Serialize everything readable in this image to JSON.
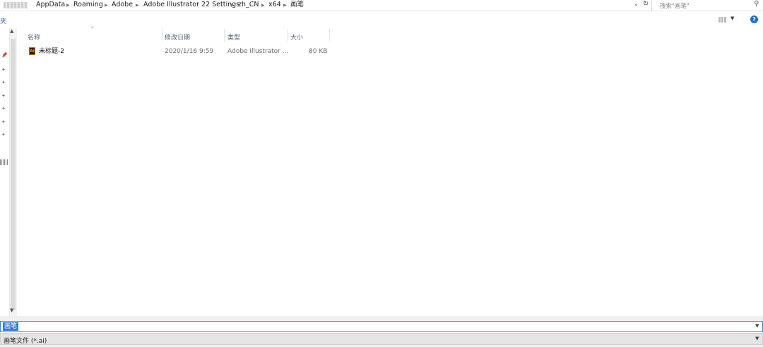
{
  "address_bar": {
    "breadcrumbs": [
      "AppData",
      "Roaming",
      "Adobe",
      "Adobe Illustrator 22 Settings",
      "zh_CN",
      "x64",
      "画笔"
    ],
    "dropdown_icon": "chevron-down-icon",
    "refresh_icon": "refresh-icon"
  },
  "search": {
    "placeholder": "搜索\"画笔\"",
    "icon": "search-icon"
  },
  "toolbar": {
    "nav_label": "夹",
    "help_label": "?"
  },
  "columns": {
    "name": "名称",
    "date": "修改日期",
    "type": "类型",
    "size": "大小"
  },
  "files": [
    {
      "name": "未标题-2",
      "date": "2020/1/16 9:59",
      "type": "Adobe Illustrator ...",
      "size": "80 KB",
      "icon": "ai-file-icon",
      "icon_text": "Ai"
    }
  ],
  "bottom": {
    "filename_value": "画笔",
    "filetype_value": "画笔文件 (*.ai)"
  },
  "colors": {
    "selection": "#3a7ad9",
    "header_text": "#4c607a",
    "link_blue": "#2b6cb8"
  }
}
